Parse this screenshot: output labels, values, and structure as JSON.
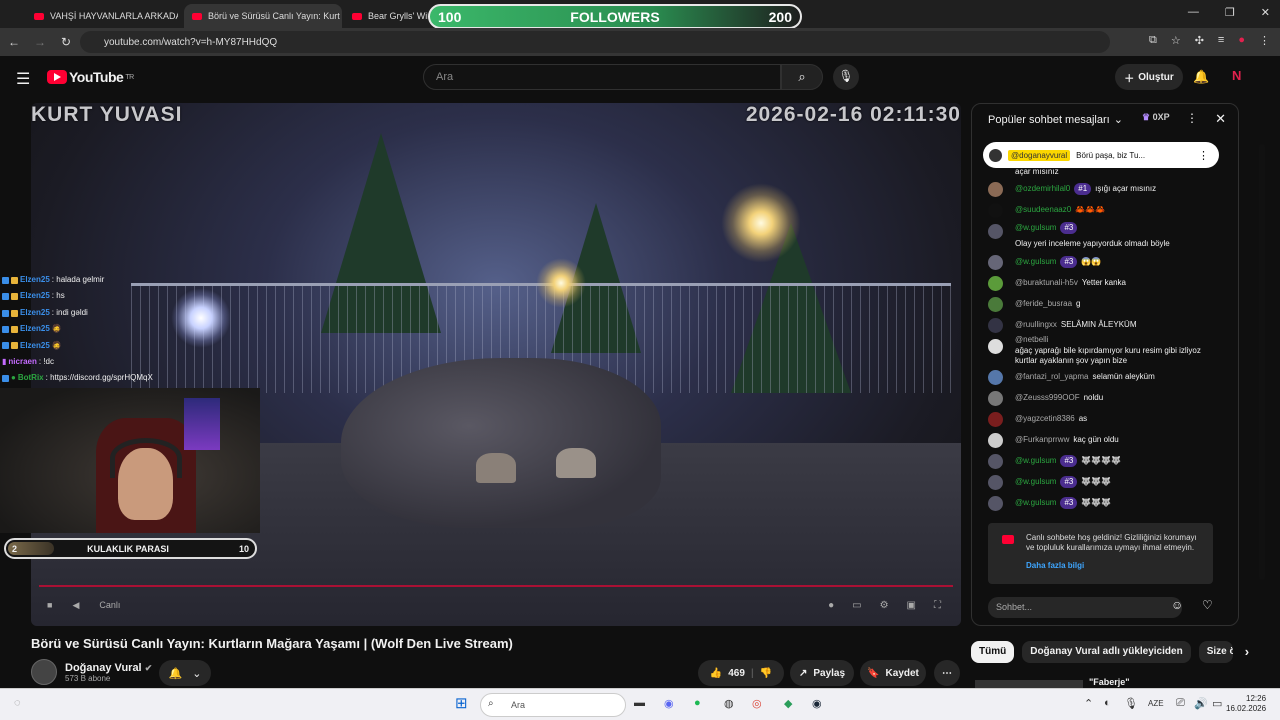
{
  "browser": {
    "tabs": [
      {
        "label": "VAHŞİ HAYVANLARLA ARKADA"
      },
      {
        "label": "Börü ve Sürüsü Canlı Yayın: Kurt"
      },
      {
        "label": "Bear Grylls' Wilde"
      }
    ],
    "url": "youtube.com/watch?v=h-MY87HHdQQ"
  },
  "followers_goal": {
    "start": "100",
    "label": "FOLLOWERS",
    "end": "200"
  },
  "youtube": {
    "logo": "YouTube",
    "region": "TR",
    "search_placeholder": "Ara",
    "create_label": "Oluştur"
  },
  "video": {
    "overlay_title": "KURT YUVASI",
    "overlay_timestamp": "2026-02-16 02:11:30",
    "live_label": "Canlı",
    "title": "Börü ve Sürüsü Canlı Yayın: Kurtların Mağara Yaşamı | (Wolf Den Live Stream)",
    "channel": "Doğanay Vural",
    "subscribers": "573 B abone",
    "likes": "469",
    "share_label": "Paylaş",
    "save_label": "Kaydet"
  },
  "stream_overlay": {
    "chat": [
      {
        "user": "Elzen25",
        "text": ": halada gelmir"
      },
      {
        "user": "Elzen25",
        "text": ": hs"
      },
      {
        "user": "Elzen25",
        "text": ": indi gəldi"
      },
      {
        "user": "Elzen25",
        "text": ""
      },
      {
        "user": "Elzen25",
        "text": ""
      },
      {
        "user": "nicraen",
        "text": ": !dc"
      },
      {
        "user": "BotRix",
        "text": ": https://discord.gg/sprHQMqX"
      }
    ],
    "goal": {
      "current": "2",
      "label": "KULAKLIK PARASI",
      "target": "10"
    }
  },
  "live_chat": {
    "header": "Popüler sohbet mesajları",
    "xp": "0XP",
    "pinned": {
      "user": "@doganayvural",
      "text": "Börü paşa, biz Tu..."
    },
    "messages": [
      {
        "user": "",
        "badge": "",
        "text": "açar mısınız",
        "member": false
      },
      {
        "user": "@ozdemirhilal0",
        "badge": "#1",
        "text": "ışığı açar mısınız",
        "member": true
      },
      {
        "user": "@suudeenaaz0",
        "badge": "",
        "text": "🦀🦀🦀",
        "member": true
      },
      {
        "user": "@w.gulsum",
        "badge": "#3",
        "text": "Olay yeri inceleme yapıyorduk olmadı böyle",
        "member": true
      },
      {
        "user": "@w.gulsum",
        "badge": "#3",
        "text": "😱😱",
        "member": true
      },
      {
        "user": "@buraktunali-h5v",
        "badge": "",
        "text": "Yetter kanka",
        "member": false
      },
      {
        "user": "@feride_busraa",
        "badge": "",
        "text": "g",
        "member": false
      },
      {
        "user": "@ruullingxx",
        "badge": "",
        "text": "SELÂMIN ÂLEYKÜM",
        "member": false
      },
      {
        "user": "@netbelli",
        "badge": "",
        "text": "ağaç yaprağı bile kıpırdamıyor kuru resim gibi izliyoz kurtlar ayaklanın şov yapın bize",
        "member": false
      },
      {
        "user": "@fantazi_rol_yapma",
        "badge": "",
        "text": "selamün aleyküm",
        "member": false
      },
      {
        "user": "@Zeusss999OOF",
        "badge": "",
        "text": "noldu",
        "member": false
      },
      {
        "user": "@yagzcetin8386",
        "badge": "",
        "text": "as",
        "member": false
      },
      {
        "user": "@Furkanprrww",
        "badge": "",
        "text": "kaç gün oldu",
        "member": false
      },
      {
        "user": "@w.gulsum",
        "badge": "#3",
        "text": "🐺🐺🐺🐺",
        "member": true
      },
      {
        "user": "@w.gulsum",
        "badge": "#3",
        "text": "🐺🐺🐺",
        "member": true
      },
      {
        "user": "@w.gulsum",
        "badge": "#3",
        "text": "🐺🐺🐺",
        "member": true
      }
    ],
    "notice": "Canlı sohbete hoş geldiniz! Gizliliğinizi korumayı ve topluluk kurallarımıza uymayı ihmal etmeyin.",
    "notice_link": "Daha fazla bilgi",
    "input_placeholder": "Sohbet..."
  },
  "chips": [
    "Tümü",
    "Doğanay Vural adlı yükleyiciden",
    "Size ö"
  ],
  "recommended_title": "\"Faberje\"",
  "taskbar": {
    "search": "Ara",
    "lang": "AZE",
    "time": "12:26",
    "date": "16.02.2026"
  }
}
